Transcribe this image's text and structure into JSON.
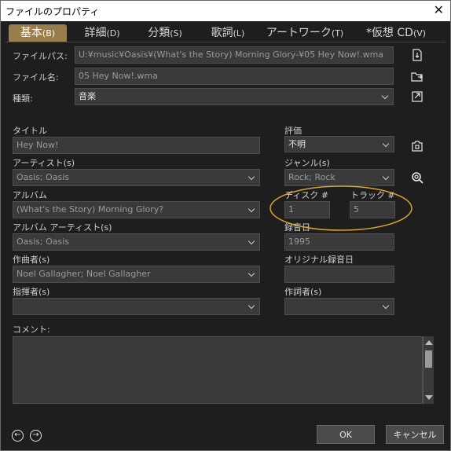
{
  "window": {
    "title": "ファイルのプロパティ",
    "close_glyph": "✕"
  },
  "tabs": [
    {
      "label": "基本",
      "accel": "(B)",
      "active": true
    },
    {
      "label": "詳細",
      "accel": "(D)"
    },
    {
      "label": "分類",
      "accel": "(S)"
    },
    {
      "label": "歌詞",
      "accel": "(L)"
    },
    {
      "label": "アートワーク",
      "accel": "(T)"
    },
    {
      "label": "*仮想 CD",
      "accel": "(V)"
    }
  ],
  "file": {
    "path_label": "ファイルパス:",
    "path_value": "U:¥music¥Oasis¥(What's the Story) Morning Glory-¥05 Hey Now!.wma",
    "name_label": "ファイル名:",
    "name_value": "05 Hey Now!.wma",
    "type_label": "種類:",
    "type_value": "音楽"
  },
  "fields": {
    "title_label": "タイトル",
    "title_value": "Hey Now!",
    "artist_label": "アーティスト(s)",
    "artist_value": "Oasis; Oasis",
    "album_label": "アルバム",
    "album_value": "(What's the Story) Morning Glory?",
    "album_artist_label": "アルバム アーティスト(s)",
    "album_artist_value": "Oasis; Oasis",
    "composer_label": "作曲者(s)",
    "composer_value": "Noel Gallagher; Noel Gallagher",
    "conductor_label": "指揮者(s)",
    "conductor_value": "",
    "rating_label": "評価",
    "rating_value": "不明",
    "genre_label": "ジャンル(s)",
    "genre_value": "Rock; Rock",
    "disc_label": "ディスク #",
    "disc_value": "1",
    "track_label": "トラック #",
    "track_value": "5",
    "date_label": "録音日",
    "date_value": "1995",
    "orig_date_label": "オリジナル録音日",
    "orig_date_value": "",
    "lyricist_label": "作詞者(s)",
    "lyricist_value": "",
    "comment_label": "コメント:",
    "comment_value": ""
  },
  "buttons": {
    "ok": "OK",
    "cancel": "キャンセル"
  },
  "colors": {
    "background": "#1e1e1e",
    "field": "#3a3a3a",
    "active_tab": "#9a7d4c",
    "highlight_ellipse": "#d9a62e"
  },
  "icons": [
    "file-open-icon",
    "rename-icon",
    "export-icon",
    "capture-icon",
    "search-web-icon",
    "prev-icon",
    "next-icon"
  ]
}
